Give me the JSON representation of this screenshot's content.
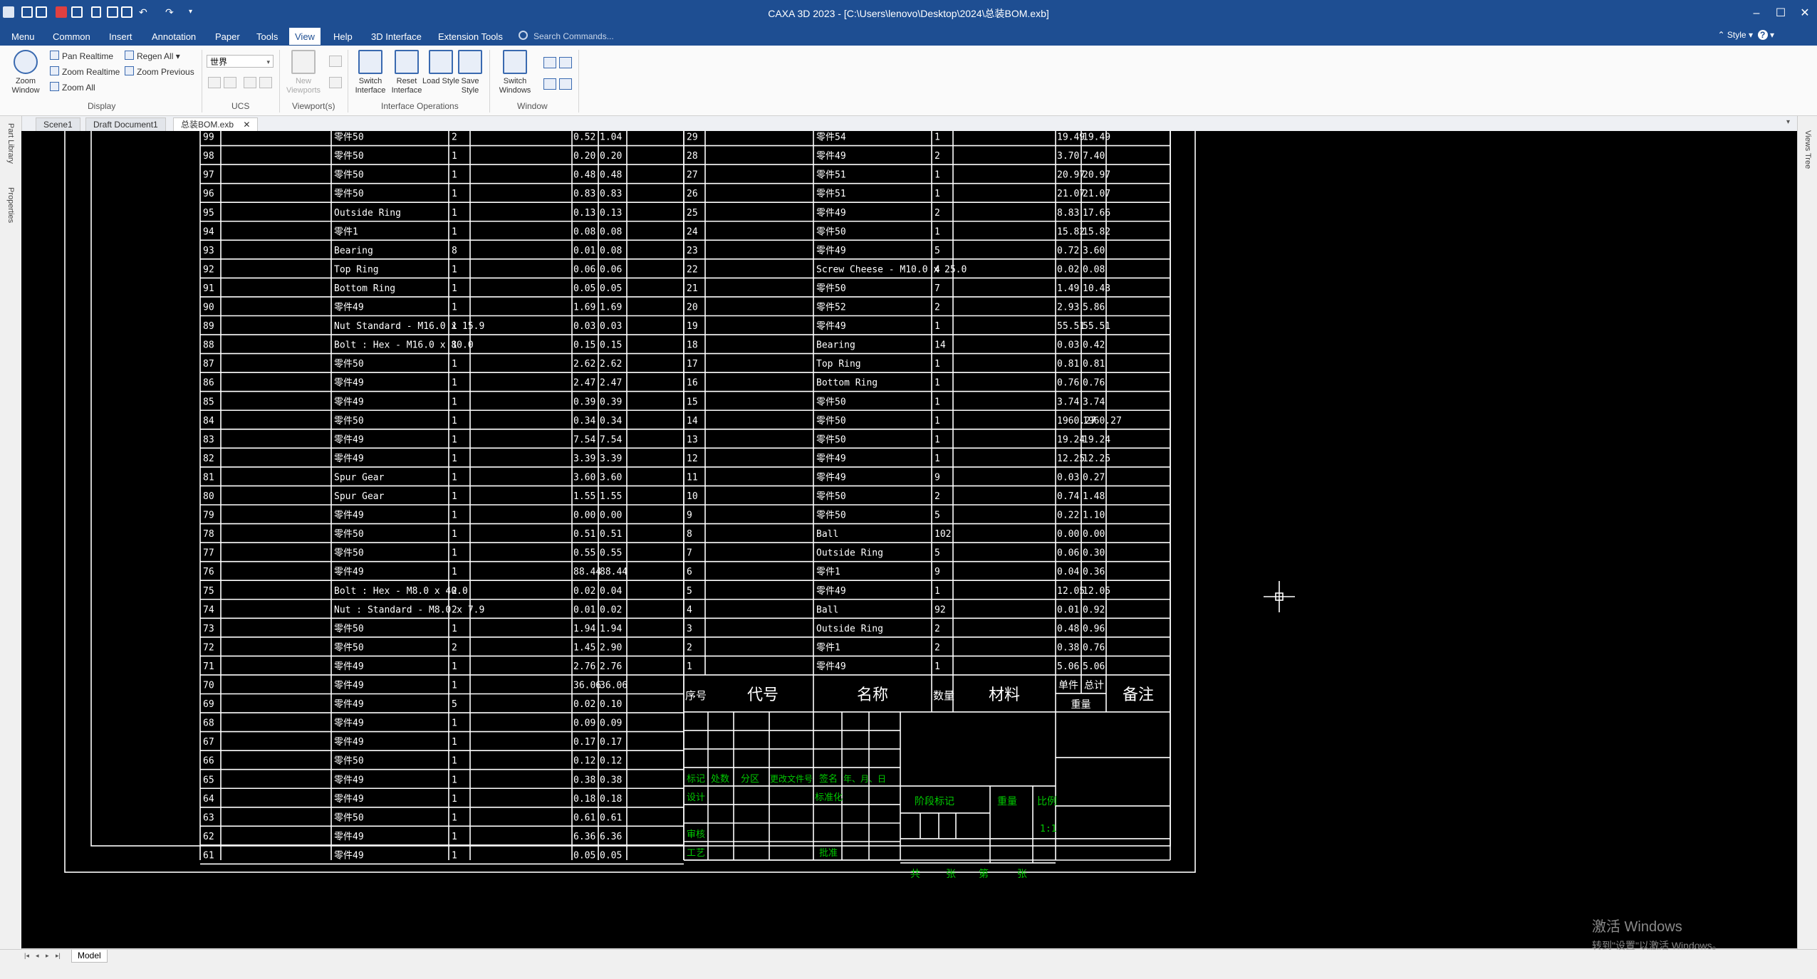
{
  "window": {
    "title": "CAXA 3D 2023 - [C:\\Users\\lenovo\\Desktop\\2024\\总装BOM.exb]",
    "controls": {
      "minimize": "–",
      "maximize": "☐",
      "close": "✕"
    }
  },
  "menubar": {
    "items": [
      "Menu",
      "Common",
      "Insert",
      "Annotation",
      "Paper",
      "Tools",
      "View",
      "Help",
      "3D Interface",
      "Extension Tools"
    ],
    "active": "View",
    "search_placeholder": "Search Commands...",
    "style_label": "Style",
    "help_glyph": "?"
  },
  "ribbon": {
    "zoom_window": "Zoom Window",
    "pan_realtime": "Pan Realtime",
    "zoom_realtime": "Zoom Realtime",
    "zoom_all": "Zoom All",
    "regen_all": "Regen All",
    "zoom_previous": "Zoom Previous",
    "display_group": "Display",
    "ucs_value": "世界",
    "ucs_group": "UCS",
    "new_viewports": "New Viewports",
    "viewports_group": "Viewport(s)",
    "switch_interface": "Switch Interface",
    "reset_interface": "Reset Interface",
    "load_style": "Load Style",
    "save_style": "Save Style",
    "interface_group": "Interface Operations",
    "switch_windows": "Switch Windows",
    "window_group": "Window"
  },
  "tabs": [
    "Scene1",
    "Draft Document1",
    "总装BOM.exb"
  ],
  "active_tab": "总装BOM.exb",
  "sidebar_left": [
    "Part Library",
    "Properties"
  ],
  "sidebar_right": [
    "Views Tree"
  ],
  "bottom": {
    "model_tab": "Model",
    "nav": [
      "|◂",
      "◂",
      "▸",
      "▸|"
    ]
  },
  "watermark": {
    "line1": "激活 Windows",
    "line2": "转到\"设置\"以激活 Windows。"
  },
  "colors": {
    "title_blue": "#1e4e92",
    "canvas": "#000000",
    "line": "#ffffff",
    "green_text": "#00c800"
  },
  "bom": {
    "left_rows": [
      [
        "99",
        "零件50",
        "2",
        "0.52",
        "1.04"
      ],
      [
        "98",
        "零件50",
        "1",
        "0.20",
        "0.20"
      ],
      [
        "97",
        "零件50",
        "1",
        "0.48",
        "0.48"
      ],
      [
        "96",
        "零件50",
        "1",
        "0.83",
        "0.83"
      ],
      [
        "95",
        "Outside Ring",
        "1",
        "0.13",
        "0.13"
      ],
      [
        "94",
        "零件1",
        "1",
        "0.08",
        "0.08"
      ],
      [
        "93",
        "Bearing",
        "8",
        "0.01",
        "0.08"
      ],
      [
        "92",
        "Top Ring",
        "1",
        "0.06",
        "0.06"
      ],
      [
        "91",
        "Bottom Ring",
        "1",
        "0.05",
        "0.05"
      ],
      [
        "90",
        "零件49",
        "1",
        "1.69",
        "1.69"
      ],
      [
        "89",
        "Nut  Standard - M16.0 x 15.9",
        "1",
        "0.03",
        "0.03"
      ],
      [
        "88",
        "Bolt : Hex - M16.0 x 80.0",
        "1",
        "0.15",
        "0.15"
      ],
      [
        "87",
        "零件50",
        "1",
        "2.62",
        "2.62"
      ],
      [
        "86",
        "零件49",
        "1",
        "2.47",
        "2.47"
      ],
      [
        "85",
        "零件49",
        "1",
        "0.39",
        "0.39"
      ],
      [
        "84",
        "零件50",
        "1",
        "0.34",
        "0.34"
      ],
      [
        "83",
        "零件49",
        "1",
        "7.54",
        "7.54"
      ],
      [
        "82",
        "零件49",
        "1",
        "3.39",
        "3.39"
      ],
      [
        "81",
        "Spur Gear",
        "1",
        "3.60",
        "3.60"
      ],
      [
        "80",
        "Spur Gear",
        "1",
        "1.55",
        "1.55"
      ],
      [
        "79",
        "零件49",
        "1",
        "0.00",
        "0.00"
      ],
      [
        "78",
        "零件50",
        "1",
        "0.51",
        "0.51"
      ],
      [
        "77",
        "零件50",
        "1",
        "0.55",
        "0.55"
      ],
      [
        "76",
        "零件49",
        "1",
        "88.44",
        "88.44"
      ],
      [
        "75",
        "Bolt : Hex - M8.0 x 40.0",
        "2",
        "0.02",
        "0.04"
      ],
      [
        "74",
        "Nut : Standard - M8.0 x 7.9",
        "2",
        "0.01",
        "0.02"
      ],
      [
        "73",
        "零件50",
        "1",
        "1.94",
        "1.94"
      ],
      [
        "72",
        "零件50",
        "2",
        "1.45",
        "2.90"
      ],
      [
        "71",
        "零件49",
        "1",
        "2.76",
        "2.76"
      ],
      [
        "70",
        "零件49",
        "1",
        "36.06",
        "36.06"
      ],
      [
        "69",
        "零件49",
        "5",
        "0.02",
        "0.10"
      ],
      [
        "68",
        "零件49",
        "1",
        "0.09",
        "0.09"
      ],
      [
        "67",
        "零件49",
        "1",
        "0.17",
        "0.17"
      ],
      [
        "66",
        "零件50",
        "1",
        "0.12",
        "0.12"
      ],
      [
        "65",
        "零件49",
        "1",
        "0.38",
        "0.38"
      ],
      [
        "64",
        "零件49",
        "1",
        "0.18",
        "0.18"
      ],
      [
        "63",
        "零件50",
        "1",
        "0.61",
        "0.61"
      ],
      [
        "62",
        "零件49",
        "1",
        "6.36",
        "6.36"
      ],
      [
        "61",
        "零件49",
        "1",
        "0.05",
        "0.05"
      ]
    ],
    "right_rows": [
      [
        "29",
        "零件54",
        "1",
        "19.49",
        "19.49"
      ],
      [
        "28",
        "零件49",
        "2",
        "3.70",
        "7.40"
      ],
      [
        "27",
        "零件51",
        "1",
        "20.97",
        "20.97"
      ],
      [
        "26",
        "零件51",
        "1",
        "21.07",
        "21.07"
      ],
      [
        "25",
        "零件49",
        "2",
        "8.83",
        "17.66"
      ],
      [
        "24",
        "零件50",
        "1",
        "15.82",
        "15.82"
      ],
      [
        "23",
        "零件49",
        "5",
        "0.72",
        "3.60"
      ],
      [
        "22",
        "Screw  Cheese - M10.0 x 25.0",
        "4",
        "0.02",
        "0.08"
      ],
      [
        "21",
        "零件50",
        "7",
        "1.49",
        "10.43"
      ],
      [
        "20",
        "零件52",
        "2",
        "2.93",
        "5.86"
      ],
      [
        "19",
        "零件49",
        "1",
        "55.51",
        "55.51"
      ],
      [
        "18",
        "Bearing",
        "14",
        "0.03",
        "0.42"
      ],
      [
        "17",
        "Top Ring",
        "1",
        "0.81",
        "0.81"
      ],
      [
        "16",
        "Bottom Ring",
        "1",
        "0.76",
        "0.76"
      ],
      [
        "15",
        "零件50",
        "1",
        "3.74",
        "3.74"
      ],
      [
        "14",
        "零件50",
        "1",
        "1960.27",
        "1960.27"
      ],
      [
        "13",
        "零件50",
        "1",
        "19.24",
        "19.24"
      ],
      [
        "12",
        "零件49",
        "1",
        "12.25",
        "12.25"
      ],
      [
        "11",
        "零件49",
        "9",
        "0.03",
        "0.27"
      ],
      [
        "10",
        "零件50",
        "2",
        "0.74",
        "1.48"
      ],
      [
        "9",
        "零件50",
        "5",
        "0.22",
        "1.10"
      ],
      [
        "8",
        "Ball",
        "102",
        "0.00",
        "0.00"
      ],
      [
        "7",
        "Outside Ring",
        "5",
        "0.06",
        "0.30"
      ],
      [
        "6",
        "零件1",
        "9",
        "0.04",
        "0.36"
      ],
      [
        "5",
        "零件49",
        "1",
        "12.05",
        "12.05"
      ],
      [
        "4",
        "Ball",
        "92",
        "0.01",
        "0.92"
      ],
      [
        "3",
        "Outside Ring",
        "2",
        "0.48",
        "0.96"
      ],
      [
        "2",
        "零件1",
        "2",
        "0.38",
        "0.76"
      ],
      [
        "1",
        "零件49",
        "1",
        "5.06",
        "5.06"
      ]
    ],
    "header": {
      "seq": "序号",
      "code": "代号",
      "name": "名称",
      "qty": "数量",
      "material": "材料",
      "unit_weight": "单件",
      "total_weight": "总计",
      "weight": "重量",
      "remark": "备注"
    },
    "title_block": {
      "mark": "标记",
      "count": "处数",
      "zone": "分区",
      "change_doc": "更改文件号",
      "signature": "签名",
      "date": "年、月、日",
      "design": "设计",
      "standardize": "标准化",
      "stage_mark": "阶段标记",
      "weight": "重量",
      "scale": "比例",
      "scale_value": "1:1",
      "review": "审核",
      "process": "工艺",
      "approve": "批准",
      "total": "共",
      "sheets": "张",
      "page_no": "第",
      "page": "张"
    }
  }
}
